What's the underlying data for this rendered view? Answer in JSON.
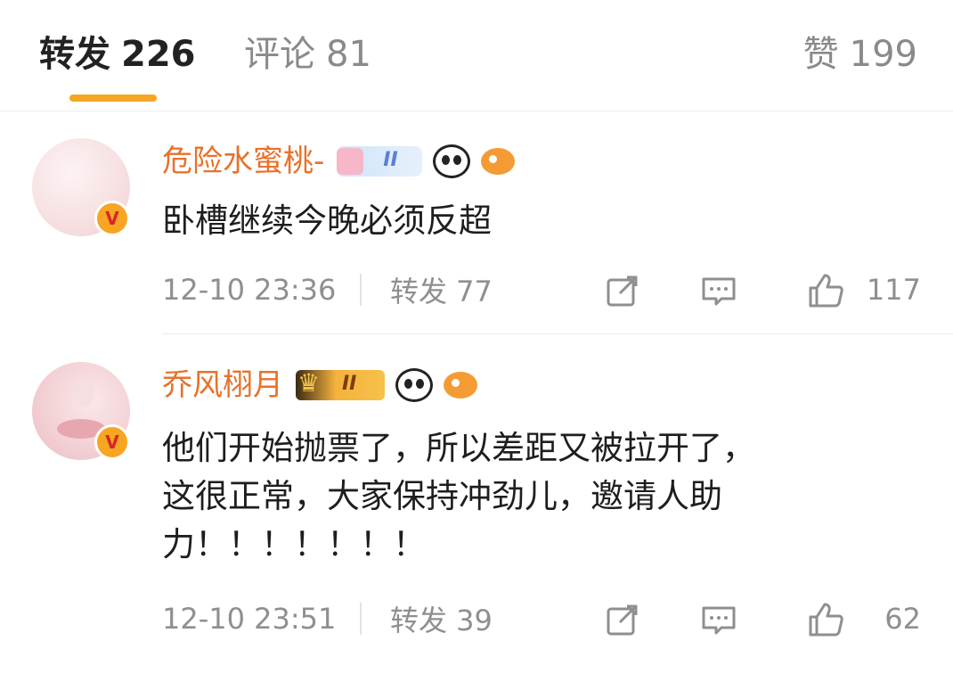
{
  "tabs": [
    {
      "label": "转发",
      "count": "226"
    },
    {
      "label": "评论",
      "count": "81"
    },
    {
      "label": "赞",
      "count": "199"
    }
  ],
  "comments": [
    {
      "username": "危险水蜜桃-",
      "badge_level": "II",
      "verified_mark": "V",
      "text_lines": [
        "卧槽继续今晚必须反超"
      ],
      "time": "12-10 23:36",
      "repost_label": "转发 77",
      "like_count": "117"
    },
    {
      "username": "乔风栩月",
      "badge_level": "II",
      "verified_mark": "V",
      "text_lines": [
        "他们开始抛票了，所以差距又被拉开了，",
        "这很正常，大家保持冲劲儿，邀请人助",
        "力！！！！！！！"
      ],
      "time": "12-10 23:51",
      "repost_label": "转发 39",
      "like_count": "62"
    }
  ],
  "colors": {
    "accent": "#f6a623",
    "username": "#e8712b",
    "meta": "#8f8f8f"
  },
  "icons": [
    "share-icon",
    "comment-icon",
    "like-icon",
    "panda-icon",
    "fish-icon",
    "crown-icon",
    "verified-badge-icon"
  ]
}
